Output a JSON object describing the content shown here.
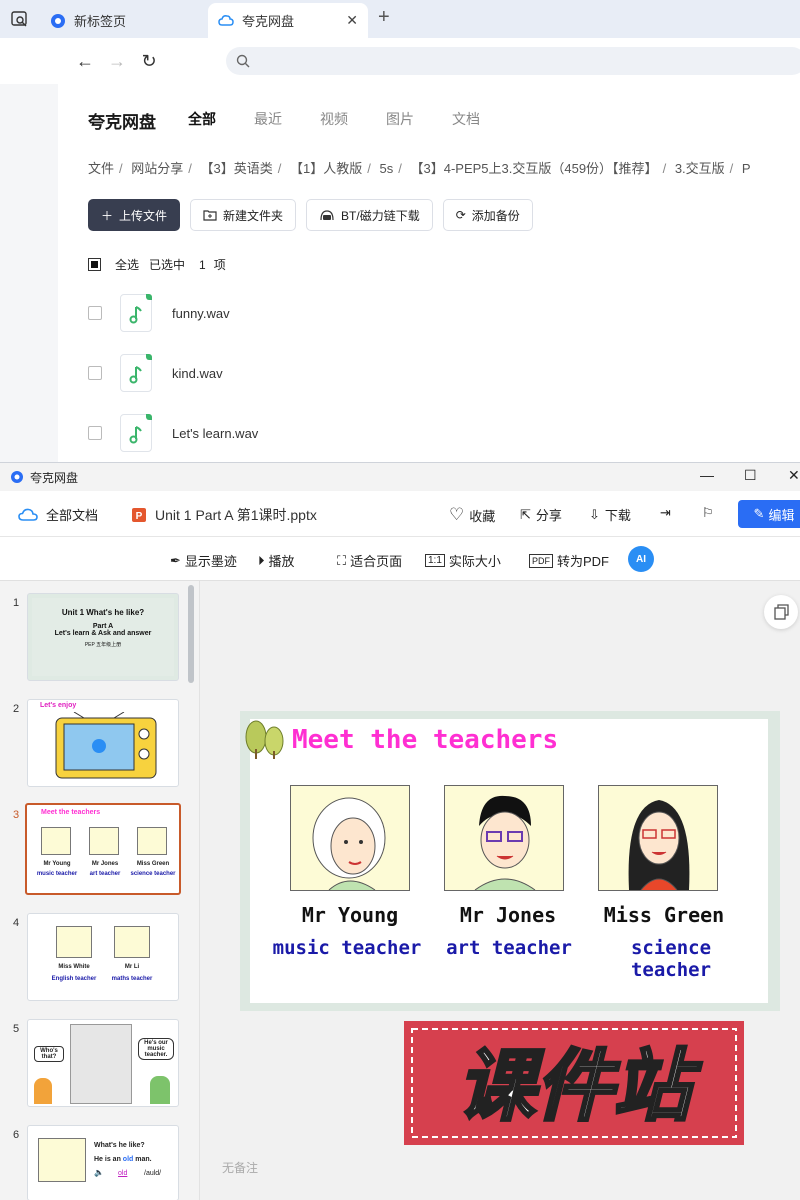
{
  "browser": {
    "tabs": [
      {
        "label": "新标签页",
        "active": false
      },
      {
        "label": "夸克网盘",
        "active": true
      }
    ],
    "new_tab": "+",
    "close": "✕"
  },
  "drive": {
    "brand": "夸克网盘",
    "nav": [
      "全部",
      "最近",
      "视频",
      "图片",
      "文档"
    ],
    "breadcrumbs": [
      "文件",
      "网站分享",
      "【3】英语类",
      "【1】人教版",
      "5s",
      "【3】4-PEP5上3.交互版（459份）【推荐】",
      "3.交互版",
      "P"
    ],
    "actions": {
      "upload": "上传文件",
      "new_folder": "新建文件夹",
      "bt": "BT/磁力链下载",
      "backup": "添加备份"
    },
    "select_all": "全选",
    "selected_prefix": "已选中",
    "selected_count": "1",
    "selected_suffix": "项",
    "files": [
      {
        "name": "funny.wav"
      },
      {
        "name": "kind.wav"
      },
      {
        "name": "Let's learn.wav"
      }
    ]
  },
  "viewer": {
    "window_title": "夸克网盘",
    "all_docs": "全部文档",
    "file_name": "Unit 1 Part A 第1课时.pptx",
    "favorite": "收藏",
    "share": "分享",
    "download": "下载",
    "edit": "编辑",
    "tools": {
      "ink": "显示墨迹",
      "play": "播放",
      "fit": "适合页面",
      "actual": "实际大小",
      "pdf": "转为PDF",
      "ai": "AI"
    },
    "notes": "无备注",
    "thumbnails": [
      {
        "num": "1",
        "title": "Unit 1   What's he like?",
        "sub1": "Part A",
        "sub2": "Let's learn & Ask and answer",
        "sub3": "PEP 五年级上册"
      },
      {
        "num": "2",
        "title": "Let's enjoy"
      },
      {
        "num": "3",
        "title": "Meet the teachers",
        "names": [
          "Mr Young",
          "Mr Jones",
          "Miss Green"
        ],
        "roles": [
          "music teacher",
          "art teacher",
          "science teacher"
        ]
      },
      {
        "num": "4",
        "names": [
          "Miss White",
          "Mr Li"
        ],
        "roles": [
          "English teacher",
          "maths teacher"
        ]
      },
      {
        "num": "5",
        "bubble1": "Who's that?",
        "bubble2": "He's our music teacher."
      },
      {
        "num": "6",
        "line1": "What's he like?",
        "line2a": "He is an ",
        "line2b": "old",
        "line2c": " man.",
        "phon": "/auld/",
        "word": "old"
      }
    ],
    "slide": {
      "title": "Meet the teachers",
      "teachers": [
        {
          "name": "Mr Young",
          "role": "music teacher"
        },
        {
          "name": "Mr Jones",
          "role": "art teacher"
        },
        {
          "name": "Miss Green",
          "role": "science teacher"
        }
      ]
    },
    "watermark": "课件站"
  },
  "colors": {
    "accent_blue": "#2a6df4",
    "slide_title": "#ff2fd2",
    "role_blue": "#1a1aa8",
    "selected_thumb": "#c85a2a",
    "watermark_red": "#d6404e"
  }
}
